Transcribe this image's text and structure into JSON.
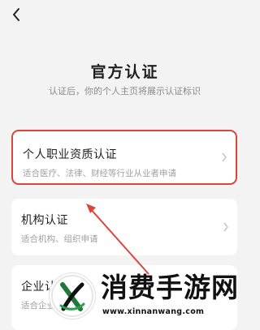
{
  "title": "官方认证",
  "subtitle": "认证后，你的个人主页将展示认证标识",
  "cards": [
    {
      "name": "个人职业资质认证",
      "desc": "适合医疗、法律、财经等行业从业者申请"
    },
    {
      "name": "机构认证",
      "desc": "适合机构、组织申请"
    },
    {
      "name": "企业认证",
      "desc": "适合企业申请"
    }
  ],
  "watermark": {
    "text": "消费手游网",
    "url": "www.xinnanwang.com"
  },
  "colors": {
    "highlight": "#d9473a",
    "background": "#f3f3f3",
    "card": "#ffffff"
  }
}
